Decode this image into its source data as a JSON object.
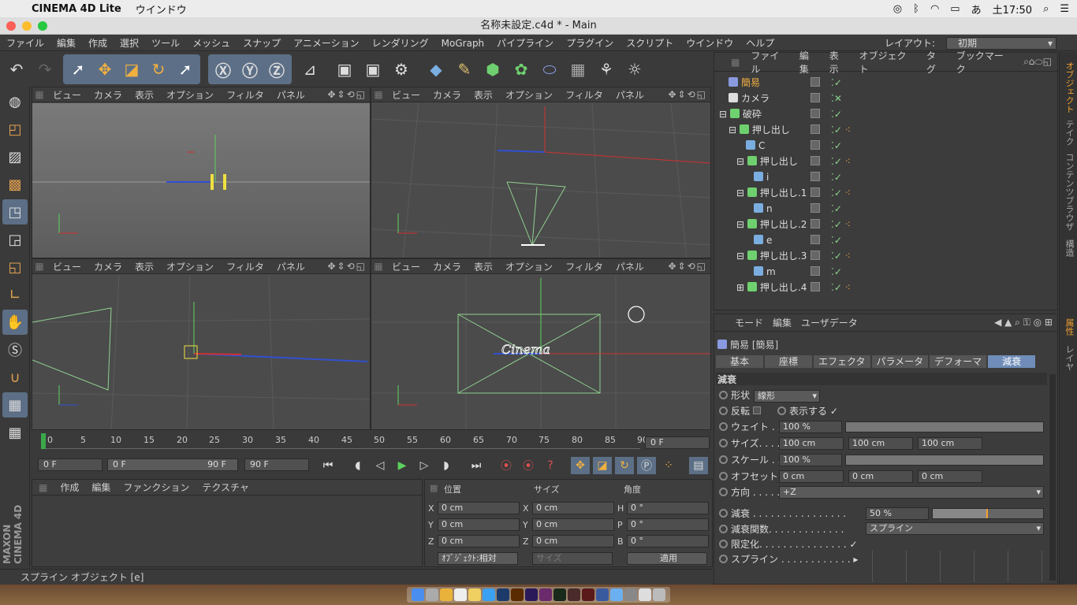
{
  "macmenu": {
    "app": "CINEMA 4D Lite",
    "window": "ウインドウ",
    "time": "土17:50",
    "ime": "あ"
  },
  "window": {
    "title": "名称未設定.c4d * - Main"
  },
  "menu": {
    "items": [
      "ファイル",
      "編集",
      "作成",
      "選択",
      "ツール",
      "メッシュ",
      "スナップ",
      "アニメーション",
      "レンダリング",
      "MoGraph",
      "パイプライン",
      "プラグイン",
      "スクリプト",
      "ウインドウ",
      "ヘルプ"
    ],
    "layout_label": "レイアウト:",
    "layout_value": "初期"
  },
  "viewport": {
    "menu": [
      "ビュー",
      "カメラ",
      "表示",
      "オプション",
      "フィルタ",
      "パネル"
    ],
    "cinema_text": "Cinema"
  },
  "timeline": {
    "ticks": [
      "0",
      "5",
      "10",
      "15",
      "20",
      "25",
      "30",
      "35",
      "40",
      "45",
      "50",
      "55",
      "60",
      "65",
      "70",
      "75",
      "80",
      "85",
      "90"
    ],
    "frame_display": "0 F",
    "start": "0 F",
    "range_start": "0 F",
    "range_end": "90 F",
    "end": "90 F"
  },
  "material": {
    "menu": [
      "作成",
      "編集",
      "ファンクション",
      "テクスチャ"
    ]
  },
  "coords": {
    "pos_label": "位置",
    "size_label": "サイズ",
    "rot_label": "角度",
    "x": "0 cm",
    "y": "0 cm",
    "z": "0 cm",
    "sx": "0 cm",
    "sy": "0 cm",
    "sz": "0 cm",
    "h": "0 °",
    "p": "0 °",
    "b": "0 °",
    "mode": "ｵﾌﾞｼﾞｪｸﾄ:相対",
    "size_mode": "サイズ",
    "apply": "適用",
    "ax": "X",
    "ay": "Y",
    "az": "Z",
    "ah": "H",
    "ap": "P",
    "ab": "B"
  },
  "status": {
    "text": "スプライン オブジェクト [e]"
  },
  "objmgr": {
    "menu": [
      "ファイル",
      "編集",
      "表示",
      "オブジェクト",
      "タグ",
      "ブックマーク"
    ],
    "rows": [
      {
        "name": "簡易"
      },
      {
        "name": "カメラ"
      },
      {
        "name": "破砕"
      },
      {
        "name": "押し出し"
      },
      {
        "name": "C"
      },
      {
        "name": "押し出し"
      },
      {
        "name": "i"
      },
      {
        "name": "押し出し.1"
      },
      {
        "name": "n"
      },
      {
        "name": "押し出し.2"
      },
      {
        "name": "e"
      },
      {
        "name": "押し出し.3"
      },
      {
        "name": "m"
      },
      {
        "name": "押し出し.4"
      }
    ]
  },
  "attr": {
    "menu": [
      "モード",
      "編集",
      "ユーザデータ"
    ],
    "object": "簡易 [簡易]",
    "tabs": [
      "基本",
      "座標",
      "エフェクタ",
      "パラメータ",
      "デフォーマ",
      "減衰"
    ],
    "section": "減衰",
    "shape_label": "形状",
    "shape_value": "線形",
    "invert_label": "反転",
    "show_label": "表示する",
    "weight_label": "ウェイト . .",
    "weight_value": "100 %",
    "size_label": "サイズ. . . .",
    "size_x": "100 cm",
    "size_y": "100 cm",
    "size_z": "100 cm",
    "scale_label": "スケール . .",
    "scale_value": "100 %",
    "offset_label": "オフセット",
    "offset_x": "0 cm",
    "offset_y": "0 cm",
    "offset_z": "0 cm",
    "dir_label": "方向 . . . . .",
    "dir_value": "+Z",
    "falloff_label": "減衰 . . . . . . . . . . . . . . . .",
    "falloff_value": "50 %",
    "func_label": "減衰関数. . . . . . . . . . . . .",
    "func_value": "スプライン",
    "limit_label": "限定化. . . . . . . . . . . . . . .",
    "spline_label": "スプライン . . . . . . . . . . . ."
  },
  "sidetabs": [
    "オブジェクト",
    "テイク",
    "コンテンツブラウザ",
    "構造"
  ],
  "sidetabs2": [
    "属性",
    "レイヤ"
  ],
  "brand": "MAXON CINEMA 4D",
  "colors": {
    "accent": "#6f8db8",
    "green": "#8cd48c",
    "axis_red": "#d03030",
    "axis_blue": "#3050d0"
  }
}
